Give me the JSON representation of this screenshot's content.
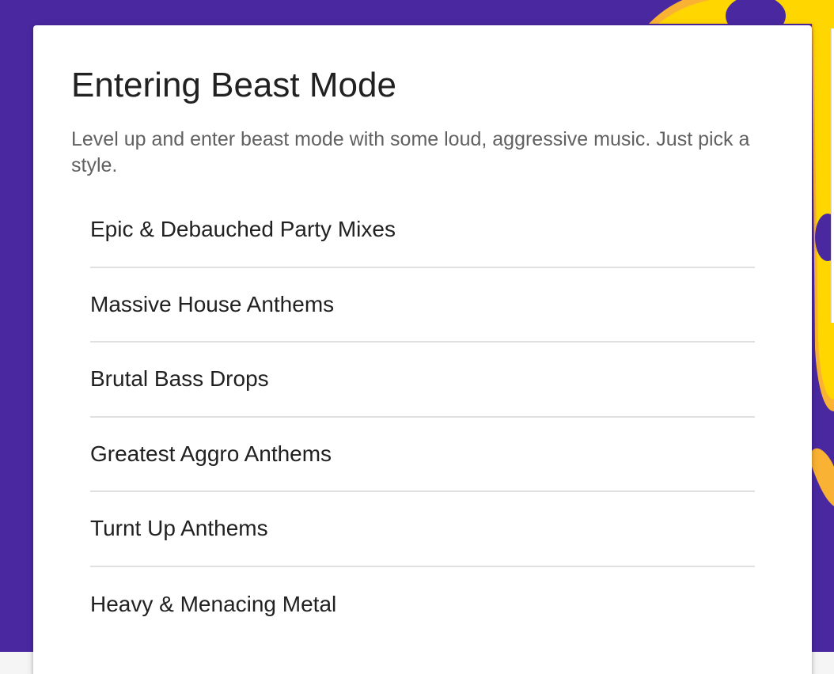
{
  "page": {
    "title": "Entering Beast Mode",
    "description": "Level up and enter beast mode with some loud, aggressive music. Just pick a style."
  },
  "styles": [
    {
      "label": "Epic & Debauched Party Mixes"
    },
    {
      "label": "Massive House Anthems"
    },
    {
      "label": "Brutal Bass Drops"
    },
    {
      "label": "Greatest Aggro Anthems"
    },
    {
      "label": "Turnt Up Anthems"
    },
    {
      "label": "Heavy & Menacing Metal"
    }
  ],
  "colors": {
    "background": "#4a28a0",
    "accent_yellow": "#ffd600",
    "accent_orange": "#f9b233",
    "card": "#ffffff",
    "title_text": "#212121",
    "description_text": "#616161",
    "divider": "#e0e0e0"
  }
}
